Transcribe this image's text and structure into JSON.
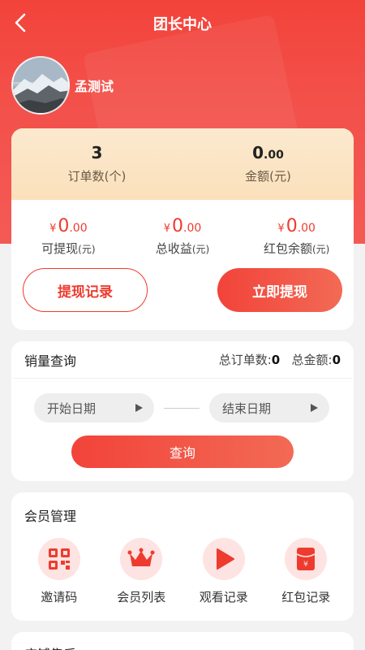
{
  "nav": {
    "title": "团长中心"
  },
  "profile": {
    "name": "孟测试"
  },
  "stats": {
    "orders_value": "3",
    "orders_label": "订单数(个)",
    "amount_int": "0",
    "amount_dec": ".00",
    "amount_label": "金额(元)"
  },
  "money": [
    {
      "yen": "¥",
      "int": "0",
      "dec": ".00",
      "label": "可提现",
      "unit": "(元)"
    },
    {
      "yen": "¥",
      "int": "0",
      "dec": ".00",
      "label": "总收益",
      "unit": "(元)"
    },
    {
      "yen": "¥",
      "int": "0",
      "dec": ".00",
      "label": "红包余额",
      "unit": "(元)"
    }
  ],
  "buttons": {
    "withdraw_record": "提现记录",
    "withdraw_now": "立即提现"
  },
  "sales": {
    "title": "销量查询",
    "total_orders_label": "总订单数:",
    "total_orders_value": "0",
    "total_amount_label": "总金额:",
    "total_amount_value": "0",
    "start_date": "开始日期",
    "end_date": "结束日期",
    "query": "查询"
  },
  "members": {
    "title": "会员管理",
    "items": [
      {
        "label": "邀请码",
        "icon": "qrcode-icon"
      },
      {
        "label": "会员列表",
        "icon": "crown-icon"
      },
      {
        "label": "观看记录",
        "icon": "play-icon"
      },
      {
        "label": "红包记录",
        "icon": "red-envelope-icon"
      }
    ]
  },
  "next_section": {
    "title": "店铺售后"
  },
  "colors": {
    "primary": "#f2433a",
    "accent_bg": "#fbe6c6",
    "icon_bg": "#fde3e1"
  }
}
